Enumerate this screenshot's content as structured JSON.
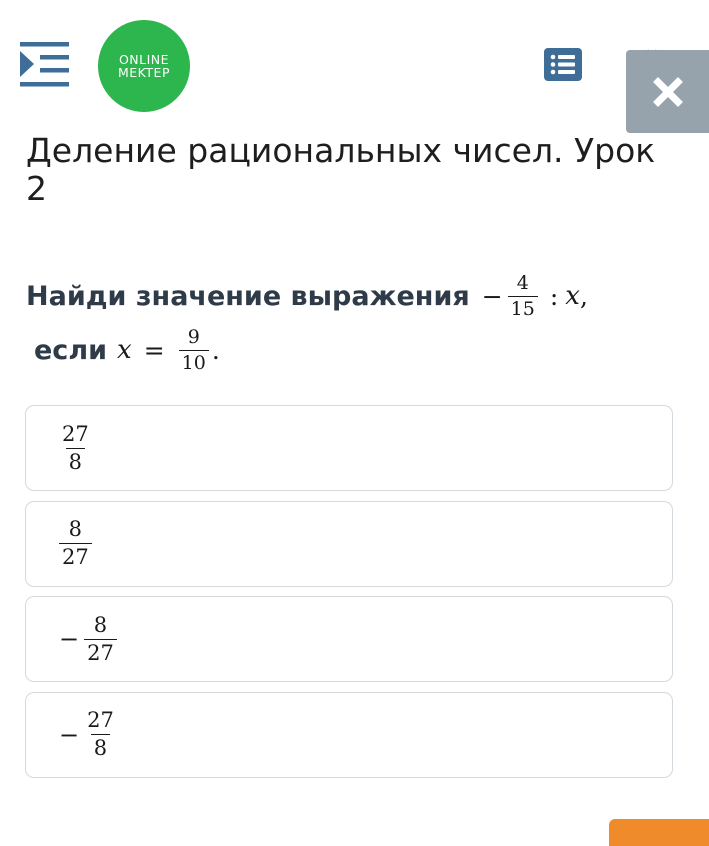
{
  "header": {
    "menu_icon": "menu-collapse-icon",
    "logo": {
      "line1": "ONLINE",
      "line2": "MEKTEP",
      "color": "#2db54e"
    },
    "list_icon": "list-icon",
    "close_icon": "close-icon"
  },
  "page_title": "Деление рациональных чисел. Урок 2",
  "question": {
    "prefix": "Найди значение выражения",
    "minus": "−",
    "fraction": {
      "num": "4",
      "den": "15"
    },
    "operator": ":",
    "variable": "x",
    "comma": ",",
    "condition_word": "если",
    "equals": "=",
    "value": {
      "num": "9",
      "den": "10"
    },
    "period": "."
  },
  "answers": [
    {
      "sign": "",
      "num": "27",
      "den": "8"
    },
    {
      "sign": "",
      "num": "8",
      "den": "27"
    },
    {
      "sign": "−",
      "num": "8",
      "den": "27"
    },
    {
      "sign": "−",
      "num": "27",
      "den": "8"
    }
  ],
  "colors": {
    "accent_orange": "#f08b2c",
    "header_blue": "#3e6e97",
    "close_gray": "#96a3ad"
  }
}
